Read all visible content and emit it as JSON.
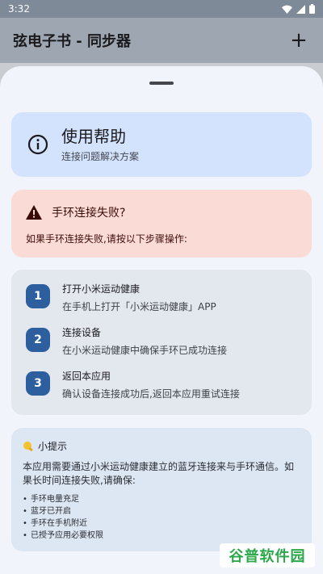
{
  "status": {
    "time": "3:32"
  },
  "app_bar": {
    "title": "弦电子书 - 同步器",
    "add_label": "+"
  },
  "help": {
    "title": "使用帮助",
    "subtitle": "连接问题解决方案"
  },
  "error": {
    "title": "手环连接失败?",
    "description": "如果手环连接失败,请按以下步骤操作:"
  },
  "steps": [
    {
      "number": "1",
      "title": "打开小米运动健康",
      "description": "在手机上打开「小米运动健康」APP"
    },
    {
      "number": "2",
      "title": "连接设备",
      "description": "在小米运动健康中确保手环已成功连接"
    },
    {
      "number": "3",
      "title": "返回本应用",
      "description": "确认设备连接成功后,返回本应用重试连接"
    }
  ],
  "tip": {
    "title": "小提示",
    "body": "本应用需要通过小米运动健康建立的蓝牙连接来与手环通信。如果长时间连接失败,请确保:",
    "items": [
      "手环电量充足",
      "蓝牙已开启",
      "手环在手机附近",
      "已授予应用必要权限"
    ]
  },
  "watermark": {
    "text": "谷普软件园"
  },
  "colors": {
    "accent": "#2d5e9e",
    "help_bg": "#d3e3fd",
    "error_bg": "#fadbd6",
    "steps_bg": "#e3e7ee",
    "tip_bg": "#dde6f3"
  }
}
